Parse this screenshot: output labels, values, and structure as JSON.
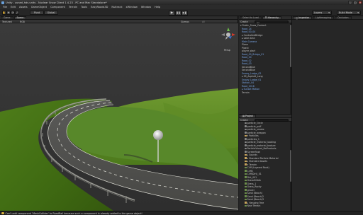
{
  "window": {
    "title": "Unity - zuned_hds.unity - Nuclear Snow Client 1.4.23 - PC and Mac Standalone*",
    "min": "–",
    "max": "□",
    "close": "✕"
  },
  "menu": [
    "File",
    "Edit",
    "Assets",
    "GameObject",
    "Component",
    "Terrain",
    "Tools",
    "EasyRoads3D",
    "Nuitrack",
    "xWindow",
    "Window",
    "Help"
  ],
  "toolbar": {
    "tools": [
      "✋",
      "✥",
      "⟳",
      "⤢"
    ],
    "pivot": "Pivot",
    "global": "Global",
    "play": "▶",
    "pause": "❚❚",
    "step": "▶❚",
    "layers": "Layers",
    "layout": "Build Mode"
  },
  "scene_panel": {
    "tabs": [
      "Game",
      "Scene"
    ],
    "active_tab": "Scene",
    "shading": "Textured",
    "render": "RGB",
    "gizmos": "Gizmos",
    "search": "All",
    "persp": "Persp"
  },
  "hierarchy": {
    "tabs": [
      "Select to Load",
      "Hierarchy"
    ],
    "create": "Create",
    "search": "All",
    "items": [
      {
        "label": "▾ Public_Snow_Content",
        "style": ""
      },
      {
        "label": "  Road_24",
        "style": "blue"
      },
      {
        "label": "  Road_00_04",
        "style": "blue"
      },
      {
        "label": "  ▸ ControlledBridge",
        "style": ""
      },
      {
        "label": "  ▸ Lake Area",
        "style": ""
      },
      {
        "label": "  Main Camera",
        "style": "blue"
      },
      {
        "label": "  Plane",
        "style": ""
      },
      {
        "label": "  Plaeki",
        "style": ""
      },
      {
        "label": "  player_start",
        "style": ""
      },
      {
        "label": "  Road_00_Bridge_01",
        "style": "blue"
      },
      {
        "label": "  Road_00",
        "style": "blue"
      },
      {
        "label": "  Road_02",
        "style": "blue"
      },
      {
        "label": "  Road_03",
        "style": "blue"
      },
      {
        "label": "  SecondBlue",
        "style": ""
      },
      {
        "label": "  SecondBlue",
        "style": ""
      },
      {
        "label": "  Snowy_Lodge_02",
        "style": "blue"
      },
      {
        "label": "  ▸ SS_Asphalt_Long",
        "style": ""
      },
      {
        "label": "  Snowy_Lodge_01",
        "style": "blue"
      },
      {
        "label": "  Station_04",
        "style": "blue"
      },
      {
        "label": "  Road_2018",
        "style": "blue"
      },
      {
        "label": "  ▸ Sunset Motion",
        "style": "blue"
      },
      {
        "label": "  Terrain",
        "style": ""
      }
    ]
  },
  "project": {
    "tabs": [
      "Project"
    ],
    "create": "Create",
    "items": [
      {
        "label": "particle_circle",
        "icon": "mat",
        "style": ""
      },
      {
        "label": "particle_puff",
        "icon": "mat",
        "style": ""
      },
      {
        "label": "particle_smoke",
        "icon": "mat",
        "style": ""
      },
      {
        "label": "particle_weapon",
        "icon": "mat",
        "style": ""
      },
      {
        "label": "▾ Particles",
        "icon": "folder",
        "style": ""
      },
      {
        "label": "particles_1",
        "icon": "mat",
        "style": ""
      },
      {
        "label": "particle_material_loading",
        "icon": "mat",
        "style": ""
      },
      {
        "label": "particle_material_texture",
        "icon": "mat",
        "style": ""
      },
      {
        "label": "ParticleVisual_NoProducts",
        "icon": "mat",
        "style": ""
      },
      {
        "label": "Screenflush",
        "icon": "mat",
        "style": ""
      },
      {
        "label": "▸ Sounds",
        "icon": "folder",
        "style": ""
      },
      {
        "label": "▸ Standard Particle Material",
        "icon": "folder",
        "style": ""
      },
      {
        "label": "▸ Standard Assets",
        "icon": "folder",
        "style": ""
      },
      {
        "label": "▾ Terrain",
        "icon": "folder",
        "style": ""
      },
      {
        "label": "Cliff (Layered Rock)",
        "icon": "tex",
        "style": ""
      },
      {
        "label": "Cliff2",
        "icon": "tex",
        "style": ""
      },
      {
        "label": "Cliff(Dirt)_01",
        "icon": "tex",
        "style": ""
      },
      {
        "label": "Dirt_001",
        "icon": "tex",
        "style": ""
      },
      {
        "label": "GrassHillAlb",
        "icon": "tex",
        "style": ""
      },
      {
        "label": "Grass_1",
        "icon": "tex",
        "style": ""
      },
      {
        "label": "Grass_Rocky",
        "icon": "tex",
        "style": ""
      },
      {
        "label": "gravel",
        "icon": "tex",
        "style": ""
      },
      {
        "label": "Sand (Beach)",
        "icon": "tex",
        "style": ""
      },
      {
        "label": "Sand (Beach)2",
        "icon": "tex",
        "style": ""
      },
      {
        "label": "Sand (Beach)3",
        "icon": "tex",
        "style": ""
      },
      {
        "label": "▸ Hanging Tree",
        "icon": "folder",
        "style": ""
      },
      {
        "label": "New Terrain",
        "icon": "tex",
        "style": ""
      }
    ]
  },
  "inspector": {
    "tabs": [
      "Inspector",
      "Lightmapping",
      "Occlusion"
    ]
  },
  "status": {
    "message": "Can't add component 'MeshCollider' to RoadRail because such a component is already added to the game object!"
  }
}
